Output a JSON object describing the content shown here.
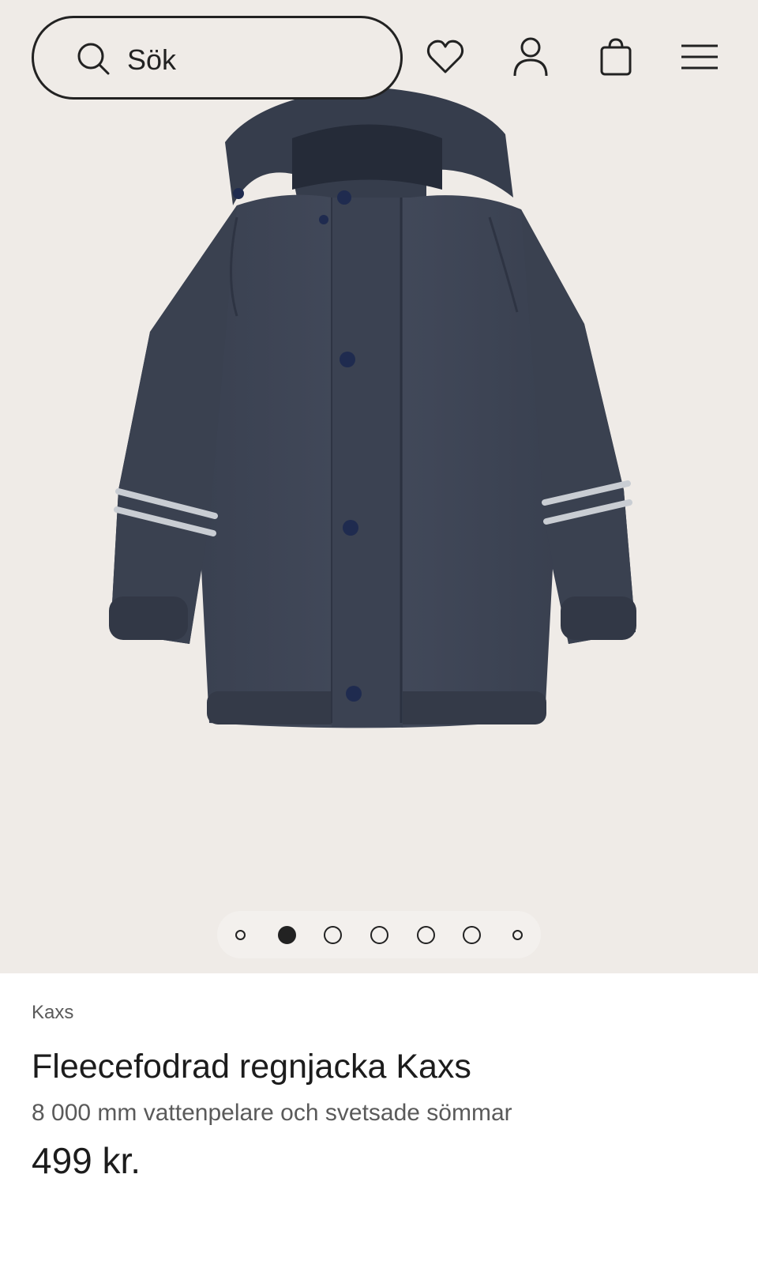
{
  "header": {
    "search": {
      "placeholder": "Sök"
    },
    "icons": [
      "search-icon",
      "heart-icon",
      "user-icon",
      "shopping-bag-icon",
      "menu-icon"
    ]
  },
  "gallery": {
    "image": "navy-fleece-lined-rain-jacket",
    "total_images": 7,
    "active_index": 2
  },
  "product": {
    "brand": "Kaxs",
    "title": "Fleecefodrad regnjacka Kaxs",
    "subtitle": "8 000 mm vattenpelare och svetsade sömmar",
    "price": "499 kr."
  },
  "colors": {
    "hero_background": "#efebe7",
    "jacket": "#3e4555",
    "reflective": "#c9cdd3",
    "text": "#1c1c1c",
    "muted_text": "#5a5a5a"
  }
}
